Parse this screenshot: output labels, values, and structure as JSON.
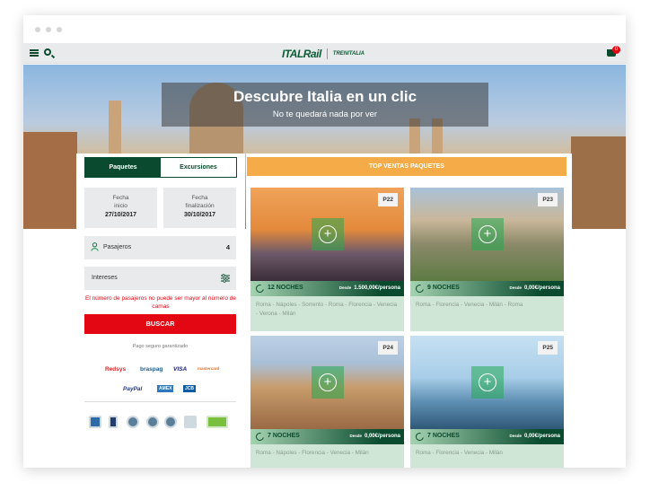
{
  "header": {
    "logo_main": "ITALRail",
    "logo_sub": "TRENITALIA",
    "cart_count": "0"
  },
  "hero": {
    "title": "Descubre Italia en un clic",
    "subtitle": "No te quedará nada por ver"
  },
  "search": {
    "tabs": [
      "Paquetes",
      "Excursiones"
    ],
    "fecha_inicio_label": "Fecha\ninicio",
    "fecha_inicio": "27/10/2017",
    "fecha_fin_label": "Fecha\nfinalización",
    "fecha_fin": "30/10/2017",
    "pasajeros_label": "Pasajeros",
    "pasajeros_value": "4",
    "intereses_label": "Intereses",
    "error": "El número de pasajeros no puede ser mayor al número de camas",
    "buscar_label": "BUSCAR",
    "pago_label": "Pago seguro garantizado",
    "payment_methods": [
      "Redsys",
      "braspag",
      "VISA",
      "mastercard",
      "PayPal",
      "AMEX",
      "JCB"
    ]
  },
  "top_ventas_label": "TOP VENTAS PAQUETES",
  "packages": [
    {
      "code": "P22",
      "nights": "12 NOCHES",
      "desde": "Desde",
      "price": "1.500,00€/persona",
      "cities": "Roma - Nápoles - Sorrento - Roma - Florencia - Venecia - Verona - Milán"
    },
    {
      "code": "P23",
      "nights": "9 NOCHES",
      "desde": "Desde",
      "price": "0,00€/persona",
      "cities": "Roma - Florencia - Venecia - Milán - Roma"
    },
    {
      "code": "P24",
      "nights": "7 NOCHES",
      "desde": "Desde",
      "price": "0,00€/persona",
      "cities": "Roma - Nápoles - Florencia - Venecia - Milán"
    },
    {
      "code": "P25",
      "nights": "7 NOCHES",
      "desde": "Desde",
      "price": "0,00€/persona",
      "cities": "Roma - Florencia - Venecia - Milán"
    }
  ],
  "colors": {
    "brand_green": "#0a4a2e",
    "accent_orange": "#f4ab48",
    "buscar_red": "#e30613"
  }
}
